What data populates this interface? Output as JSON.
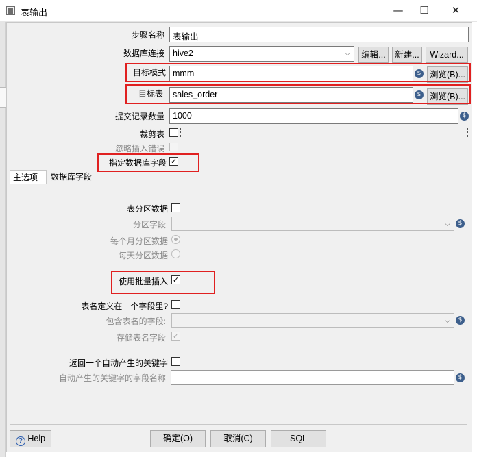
{
  "window": {
    "title": "表输出",
    "min": "—",
    "max": "☐",
    "close": "✕"
  },
  "fields": {
    "step_name": {
      "label": "步骤名称",
      "value": "表输出"
    },
    "connection": {
      "label": "数据库连接",
      "value": "hive2",
      "edit": "编辑...",
      "new": "新建...",
      "wizard": "Wizard..."
    },
    "target_schema": {
      "label": "目标模式",
      "value": "mmm",
      "browse": "浏览(B)..."
    },
    "target_table": {
      "label": "目标表",
      "value": "sales_order",
      "browse": "浏览(B)..."
    },
    "commit_size": {
      "label": "提交记录数量",
      "value": "1000"
    },
    "truncate": {
      "label": "裁剪表"
    },
    "ignore_errors": {
      "label": "忽略插入错误"
    },
    "specify_fields": {
      "label": "指定数据库字段",
      "checked": true
    }
  },
  "tabs": [
    {
      "label": "主选项"
    },
    {
      "label": "数据库字段"
    }
  ],
  "main": {
    "partition": {
      "label": "表分区数据"
    },
    "partition_field": {
      "label": "分区字段"
    },
    "monthly": {
      "label": "每个月分区数据"
    },
    "daily": {
      "label": "每天分区数据"
    },
    "batch": {
      "label": "使用批量插入",
      "checked": true
    },
    "table_in_field": {
      "label": "表名定义在一个字段里?"
    },
    "table_field": {
      "label": "包含表名的字段:"
    },
    "store_table_field": {
      "label": "存储表名字段"
    },
    "return_key": {
      "label": "返回一个自动产生的关键字"
    },
    "key_field": {
      "label": "自动产生的关键字的字段名称"
    }
  },
  "footer": {
    "help": "Help",
    "ok": "确定(O)",
    "cancel": "取消(C)",
    "sql": "SQL"
  },
  "colors": {
    "highlight": "#e02020",
    "var_icon": "#3d5f8c",
    "dialog_bg": "#f0f0f0"
  },
  "icons": {
    "variable": "dollar-diamond-icon",
    "help": "question-circle-icon"
  }
}
